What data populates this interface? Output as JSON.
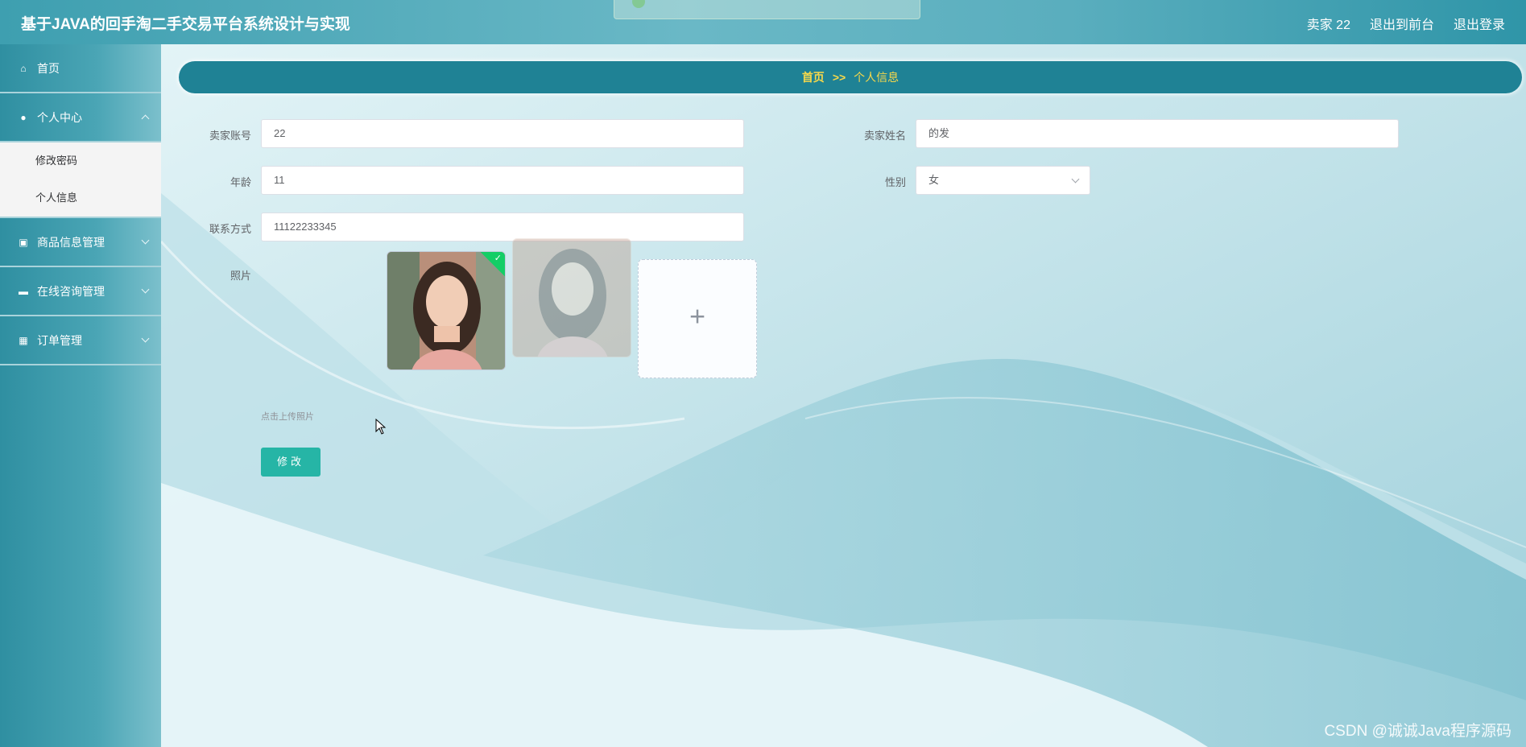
{
  "app": {
    "title": "基于JAVA的回手淘二手交易平台系统设计与实现",
    "user_label": "卖家 22",
    "front_label": "退出到前台",
    "logout_label": "退出登录"
  },
  "sidebar": {
    "items": [
      {
        "label": "首页",
        "icon": "home-icon"
      },
      {
        "label": "个人中心",
        "icon": "user-icon",
        "children": [
          "修改密码",
          "个人信息"
        ]
      },
      {
        "label": "商品信息管理",
        "icon": "goods-icon"
      },
      {
        "label": "在线咨询管理",
        "icon": "chat-icon"
      },
      {
        "label": "订单管理",
        "icon": "grid-icon"
      }
    ]
  },
  "breadcrumb": {
    "home": "首页",
    "separator": ">>",
    "current": "个人信息"
  },
  "form": {
    "account_label": "卖家账号",
    "account_value": "22",
    "name_label": "卖家姓名",
    "name_value": "的发",
    "age_label": "年龄",
    "age_value": "11",
    "gender_label": "性别",
    "gender_value": "女",
    "phone_label": "联系方式",
    "phone_value": "11122233345",
    "photo_label": "照片",
    "upload_hint": "点击上传照片",
    "submit_label": "修改"
  },
  "watermark": "CSDN @诚诚Java程序源码"
}
